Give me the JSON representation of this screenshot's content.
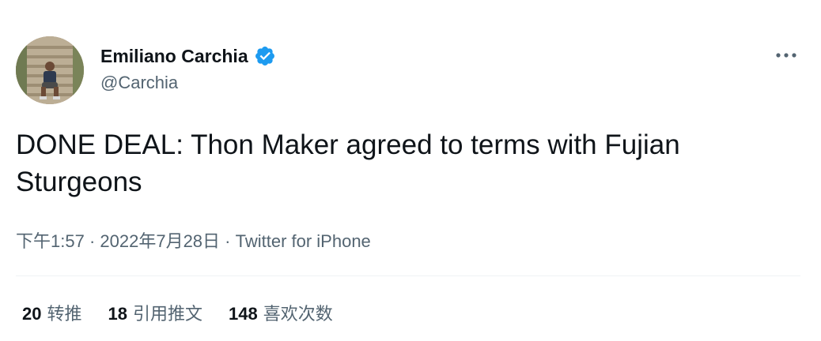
{
  "author": {
    "display_name": "Emiliano Carchia",
    "handle": "@Carchia",
    "verified_icon": "verified-badge-icon",
    "verified_color": "#1d9bf0"
  },
  "more_icon": "more-horizontal-icon",
  "tweet": {
    "text": "DONE DEAL: Thon Maker agreed to terms with Fujian Sturgeons"
  },
  "meta": {
    "time": "下午1:57",
    "separator": " · ",
    "date": "2022年7月28日",
    "source": "Twitter for iPhone"
  },
  "stats": [
    {
      "count": "20",
      "label": "转推"
    },
    {
      "count": "18",
      "label": "引用推文"
    },
    {
      "count": "148",
      "label": "喜欢次数"
    }
  ],
  "colors": {
    "text_primary": "#0f1419",
    "text_secondary": "#536471",
    "divider": "#eff3f4"
  }
}
